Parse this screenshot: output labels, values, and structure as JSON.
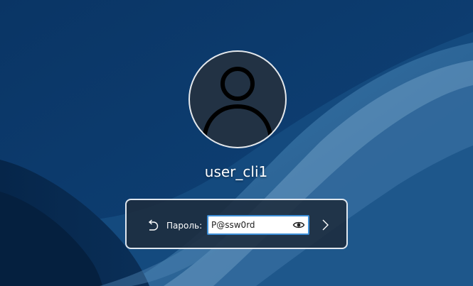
{
  "user": {
    "name": "user_cli1"
  },
  "login": {
    "password_label": "Пароль:",
    "password_value": "P@ssw0rd"
  },
  "icons": {
    "avatar": "user-silhouette",
    "back": "undo-arrow",
    "reveal": "eye",
    "submit": "chevron-right"
  },
  "colors": {
    "background": "#0b3767",
    "focus_border": "#3d8fd8"
  }
}
